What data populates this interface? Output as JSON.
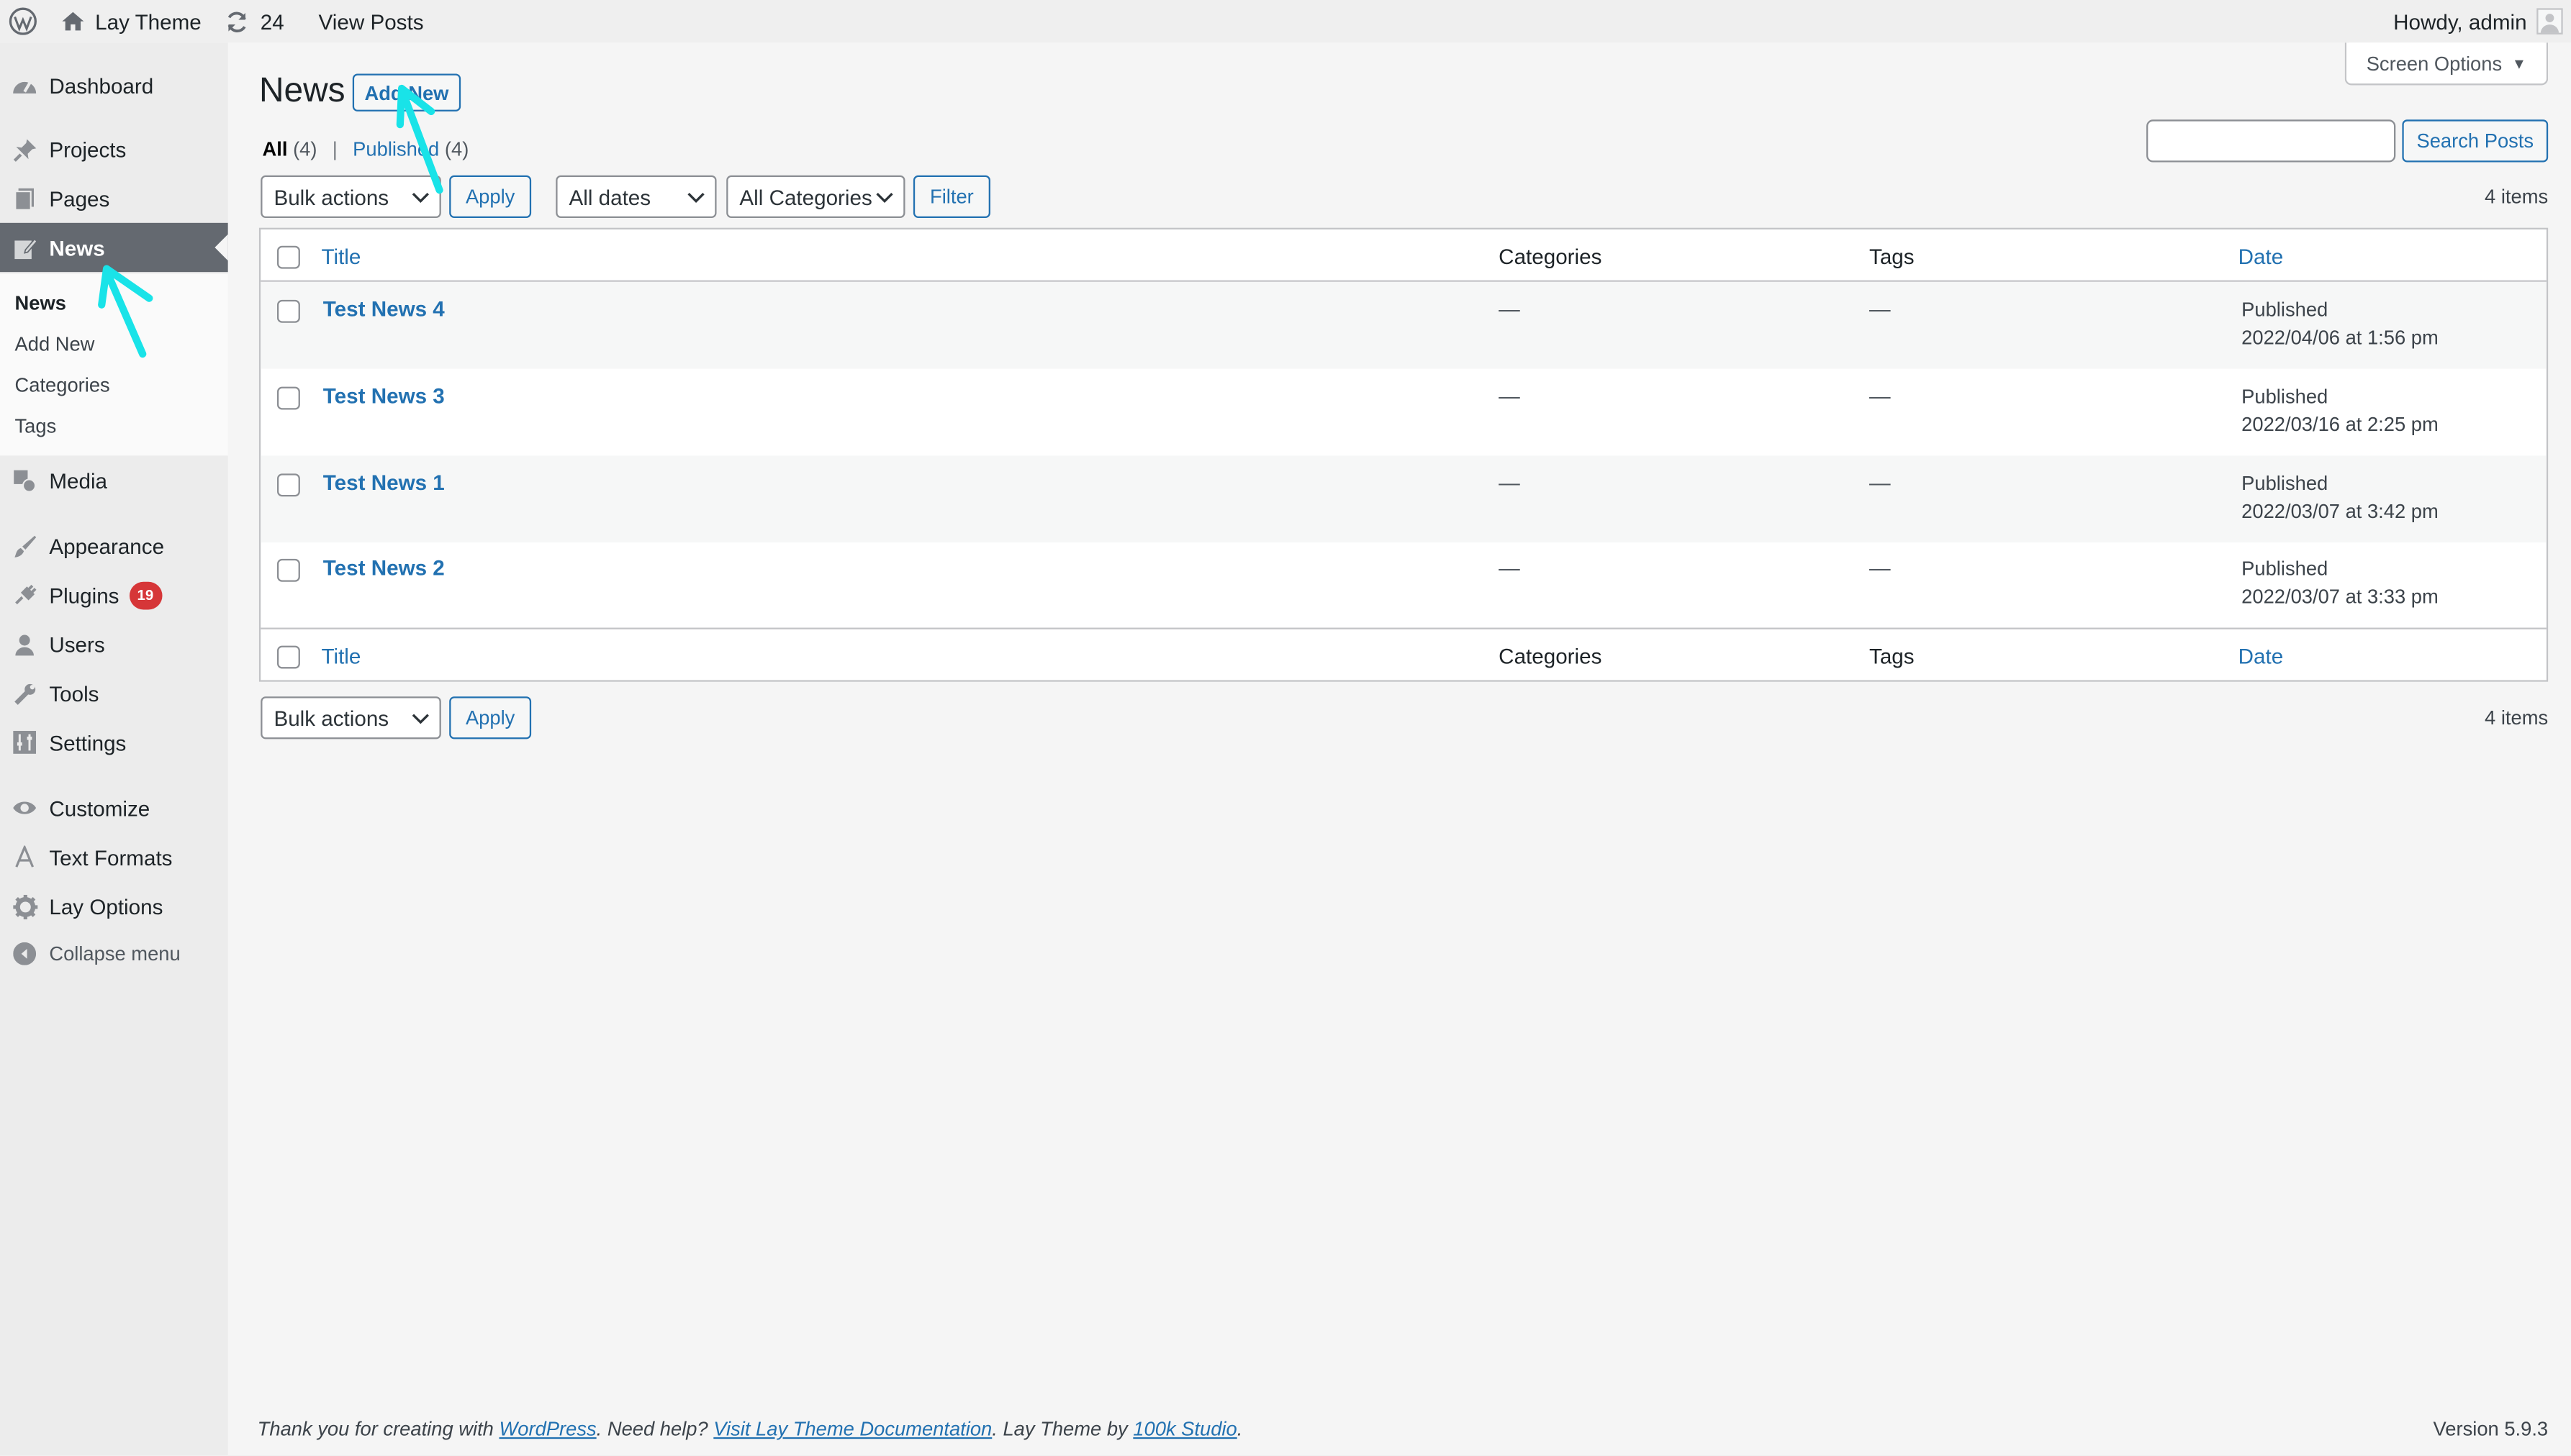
{
  "admin_bar": {
    "site_name": "Lay Theme",
    "updates_count": "24",
    "view_posts": "View Posts",
    "howdy": "Howdy, admin"
  },
  "sidebar": {
    "items": {
      "dashboard": "Dashboard",
      "projects": "Projects",
      "pages": "Pages",
      "news": "News",
      "media": "Media",
      "appearance": "Appearance",
      "plugins": "Plugins",
      "plugins_badge": "19",
      "users": "Users",
      "tools": "Tools",
      "settings": "Settings",
      "customize": "Customize",
      "text_formats": "Text Formats",
      "lay_options": "Lay Options",
      "collapse": "Collapse menu"
    },
    "submenu": {
      "news": "News",
      "add_new": "Add New",
      "categories": "Categories",
      "tags": "Tags"
    }
  },
  "header": {
    "page_title": "News",
    "add_new": "Add New",
    "screen_options": "Screen Options"
  },
  "views": {
    "all_label": "All",
    "all_count": "(4)",
    "separator": "|",
    "published_label": "Published",
    "published_count": "(4)"
  },
  "search": {
    "placeholder": "",
    "button": "Search Posts"
  },
  "filters": {
    "bulk_actions": "Bulk actions",
    "apply": "Apply",
    "all_dates": "All dates",
    "all_categories": "All Categories",
    "filter": "Filter",
    "items_count": "4 items"
  },
  "table": {
    "columns": {
      "title": "Title",
      "categories": "Categories",
      "tags": "Tags",
      "date": "Date"
    },
    "rows": [
      {
        "title": "Test News 4",
        "categories": "—",
        "tags": "—",
        "status": "Published",
        "date": "2022/04/06 at 1:56 pm"
      },
      {
        "title": "Test News 3",
        "categories": "—",
        "tags": "—",
        "status": "Published",
        "date": "2022/03/16 at 2:25 pm"
      },
      {
        "title": "Test News 1",
        "categories": "—",
        "tags": "—",
        "status": "Published",
        "date": "2022/03/07 at 3:42 pm"
      },
      {
        "title": "Test News 2",
        "categories": "—",
        "tags": "—",
        "status": "Published",
        "date": "2022/03/07 at 3:33 pm"
      }
    ]
  },
  "footer": {
    "thanks_pre": "Thank you for creating with ",
    "wordpress_link": "WordPress",
    "help_pre": ". Need help? ",
    "docs_link": "Visit Lay Theme Documentation",
    "by_pre": ". Lay Theme by ",
    "studio_link": "100k Studio",
    "end": ".",
    "version": "Version 5.9.3"
  },
  "colors": {
    "link_blue": "#2271b1",
    "menu_current_bg": "#646970",
    "badge_red": "#d63638",
    "annotation_cyan": "#19e3e8"
  }
}
